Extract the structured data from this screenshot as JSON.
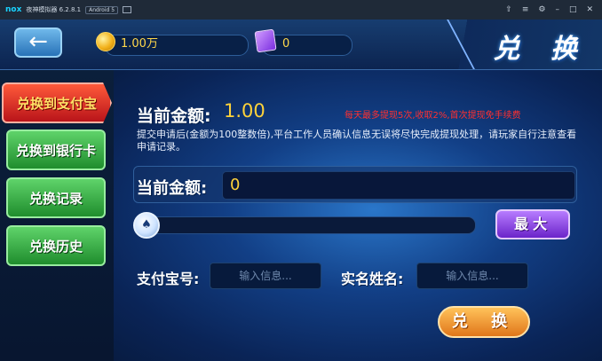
{
  "emulator": {
    "logo": "nox",
    "title": "夜神模拟器 6.2.8.1",
    "android_tag": "Android 5",
    "controls": [
      "⇧",
      "≡",
      "⚙",
      "–",
      "□",
      "✕"
    ]
  },
  "topbar": {
    "back_icon": "←",
    "coins": "1.00万",
    "gems": "0",
    "title": "兑 换"
  },
  "sidebar": {
    "items": [
      {
        "label": "兑换到支付宝",
        "active": true
      },
      {
        "label": "兑换到银行卡",
        "active": false
      },
      {
        "label": "兑换记录",
        "active": false
      },
      {
        "label": "兑换历史",
        "active": false
      }
    ]
  },
  "main": {
    "amount_label": "当前金额:",
    "amount_value": "1.00",
    "notice": "每天最多提现5次,收取2%,首次提现免手续费",
    "info_text": "提交申请后(金额为100整数倍),平台工作人员确认信息无误将尽快完成提现处理，请玩家自行注意查看申请记录。",
    "input_label": "当前金额:",
    "input_value": "0",
    "slider_value": 0,
    "max_button": "最大",
    "alipay_label": "支付宝号:",
    "alipay_placeholder": "输入信息...",
    "name_label": "实名姓名:",
    "name_placeholder": "输入信息...",
    "submit_button": "兑 换"
  },
  "colors": {
    "accent_gold": "#ffd23a",
    "notice_red": "#ff3030",
    "active_tab_red": "#d0281f",
    "tab_green": "#2fae3c",
    "max_purple": "#8a3ae3",
    "submit_orange": "#f0962a"
  }
}
